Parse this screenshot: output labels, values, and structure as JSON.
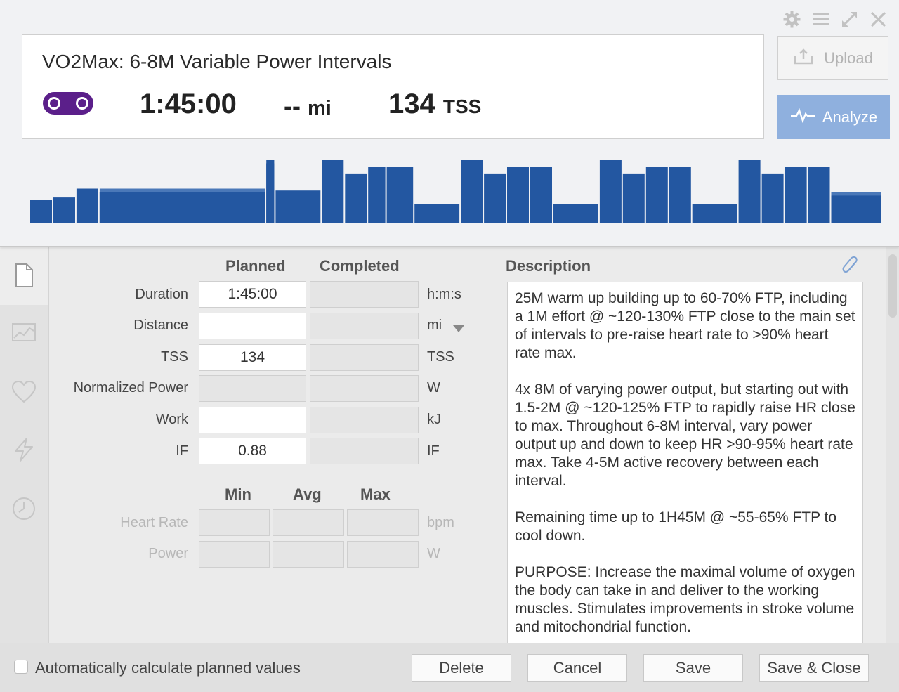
{
  "workout": {
    "title": "VO2Max: 6-8M Variable Power Intervals",
    "sport_icon": "bike-chain-icon",
    "duration": "1:45:00",
    "distance_value": "--",
    "distance_unit": "mi",
    "tss_value": "134",
    "tss_unit": "TSS"
  },
  "window_controls": [
    "gear-icon",
    "menu-icon",
    "expand-icon",
    "close-icon"
  ],
  "actions": {
    "upload": "Upload",
    "analyze": "Analyze"
  },
  "colors": {
    "bar_primary": "#2357a1",
    "bar_secondary": "#4a78b8",
    "analyze_bg": "#8fb0de",
    "sport_purple": "#5b1f8a"
  },
  "workout_profile": {
    "description": "relative interval intensity (0-1), 0-105 minutes",
    "segments": [
      [
        0,
        5,
        0.37
      ],
      [
        5,
        10,
        0.41
      ],
      [
        10,
        15,
        0.55
      ],
      [
        15,
        51,
        0.5
      ],
      [
        15,
        51,
        0.55
      ],
      [
        51,
        53,
        1.0
      ],
      [
        51,
        53,
        0.95
      ],
      [
        53,
        63,
        0.52
      ],
      [
        63,
        68,
        1.0
      ],
      [
        68,
        73,
        0.79
      ],
      [
        73,
        77,
        0.9
      ],
      [
        77,
        83,
        0.9
      ],
      [
        83,
        93,
        0.3
      ],
      [
        93,
        98,
        1.0
      ],
      [
        98,
        103,
        0.79
      ],
      [
        103,
        108,
        0.9
      ],
      [
        108,
        113,
        0.9
      ],
      [
        113,
        123,
        0.3
      ],
      [
        123,
        128,
        1.0
      ],
      [
        128,
        133,
        0.79
      ],
      [
        133,
        138,
        0.9
      ],
      [
        138,
        143,
        0.9
      ],
      [
        143,
        153,
        0.3
      ],
      [
        153,
        158,
        1.0
      ],
      [
        158,
        163,
        0.79
      ],
      [
        163,
        168,
        0.9
      ],
      [
        168,
        173,
        0.9
      ],
      [
        173,
        184,
        0.44
      ],
      [
        173,
        184,
        0.5
      ]
    ]
  },
  "tabs": [
    "summary-icon",
    "chart-icon",
    "heart-icon",
    "power-icon",
    "clock-icon"
  ],
  "columns": {
    "planned": "Planned",
    "completed": "Completed"
  },
  "metrics": [
    {
      "label": "Duration",
      "planned": "1:45:00",
      "completed": "",
      "unit": "h:m:s"
    },
    {
      "label": "Distance",
      "planned": "",
      "completed": "",
      "unit": "mi"
    },
    {
      "label": "TSS",
      "planned": "134",
      "completed": "",
      "unit": "TSS"
    },
    {
      "label": "Normalized Power",
      "planned": "",
      "completed": "",
      "unit": "W"
    },
    {
      "label": "Work",
      "planned": "",
      "completed": "",
      "unit": "kJ"
    },
    {
      "label": "IF",
      "planned": "0.88",
      "completed": "",
      "unit": "IF"
    }
  ],
  "minmax": {
    "min": "Min",
    "avg": "Avg",
    "max": "Max",
    "rows": [
      {
        "label": "Heart Rate",
        "unit": "bpm"
      },
      {
        "label": "Power",
        "unit": "W"
      }
    ]
  },
  "description": {
    "header": "Description",
    "paragraphs": [
      "25M warm up building up to 60-70% FTP, including a 1M effort @ ~120-130% FTP close to the main set of intervals to pre-raise heart rate to >90% heart rate max.",
      "4x 8M of varying power output, but starting out with 1.5-2M @ ~120-125% FTP to rapidly raise HR close to max. Throughout 6-8M interval, vary power output up and down to keep HR >90-95% heart rate max. Take 4-5M active recovery between each interval.",
      "Remaining time up to 1H45M @ ~55-65% FTP to cool down.",
      "PURPOSE: Increase the maximal volume of oxygen the body can take in and deliver to the working muscles. Stimulates improvements in stroke volume and mitochondrial function."
    ]
  },
  "footer": {
    "auto_calc_label": "Automatically calculate planned values",
    "auto_calc_checked": false,
    "delete": "Delete",
    "cancel": "Cancel",
    "save": "Save",
    "save_close": "Save & Close"
  }
}
